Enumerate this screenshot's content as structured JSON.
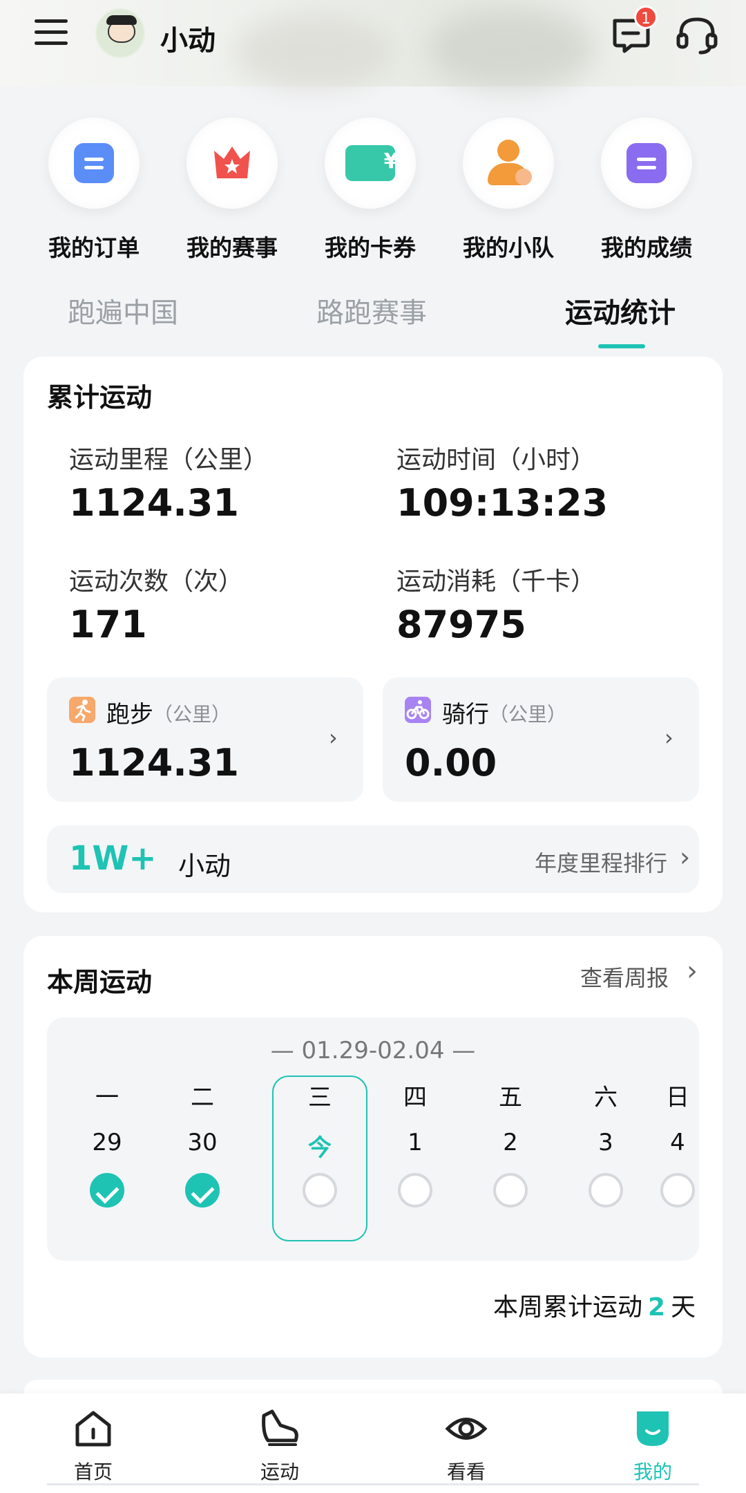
{
  "header": {
    "username": "小动",
    "message_badge": "1"
  },
  "quick_menu": [
    {
      "label": "我的订单",
      "icon": "order-icon",
      "color": "#5b8df7"
    },
    {
      "label": "我的赛事",
      "icon": "event-crown-icon",
      "color": "#f0524d"
    },
    {
      "label": "我的卡券",
      "icon": "coupon-icon",
      "color": "#36c8a8"
    },
    {
      "label": "我的小队",
      "icon": "team-icon",
      "color": "#f39a3a"
    },
    {
      "label": "我的成绩",
      "icon": "score-icon",
      "color": "#8a6cf0"
    }
  ],
  "tabs": [
    {
      "label": "跑遍中国",
      "active": false
    },
    {
      "label": "路跑赛事",
      "active": false
    },
    {
      "label": "运动统计",
      "active": true
    }
  ],
  "cumulative": {
    "title": "累计运动",
    "distance_label": "运动里程（公里）",
    "distance_value": "1124.31",
    "time_label": "运动时间（小时）",
    "time_value": "109:13:23",
    "count_label": "运动次数（次）",
    "count_value": "171",
    "calories_label": "运动消耗（千卡）",
    "calories_value": "87975",
    "running": {
      "label": "跑步",
      "unit": "（公里）",
      "value": "1124.31"
    },
    "cycling": {
      "label": "骑行",
      "unit": "（公里）",
      "value": "0.00"
    },
    "ranking": {
      "count": "1W+",
      "name": "小动",
      "link": "年度里程排行"
    }
  },
  "week": {
    "title": "本周运动",
    "report_link": "查看周报",
    "range": "— 01.29-02.04 —",
    "days": [
      {
        "name": "一",
        "num": "29",
        "done": true
      },
      {
        "name": "二",
        "num": "30",
        "done": true
      },
      {
        "name": "三",
        "num": "今",
        "done": false,
        "today": true
      },
      {
        "name": "四",
        "num": "1",
        "done": false
      },
      {
        "name": "五",
        "num": "2",
        "done": false
      },
      {
        "name": "六",
        "num": "3",
        "done": false
      },
      {
        "name": "日",
        "num": "4",
        "done": false
      }
    ],
    "total_prefix": "本周累计运动",
    "total_days": "2",
    "total_suffix": "天"
  },
  "bottom_nav": [
    {
      "label": "首页",
      "icon": "home-icon",
      "active": false
    },
    {
      "label": "运动",
      "icon": "shoe-icon",
      "active": false
    },
    {
      "label": "看看",
      "icon": "eye-icon",
      "active": false
    },
    {
      "label": "我的",
      "icon": "profile-icon",
      "active": true
    }
  ],
  "colors": {
    "accent": "#1ec3b4",
    "badge": "#f04a3e"
  }
}
